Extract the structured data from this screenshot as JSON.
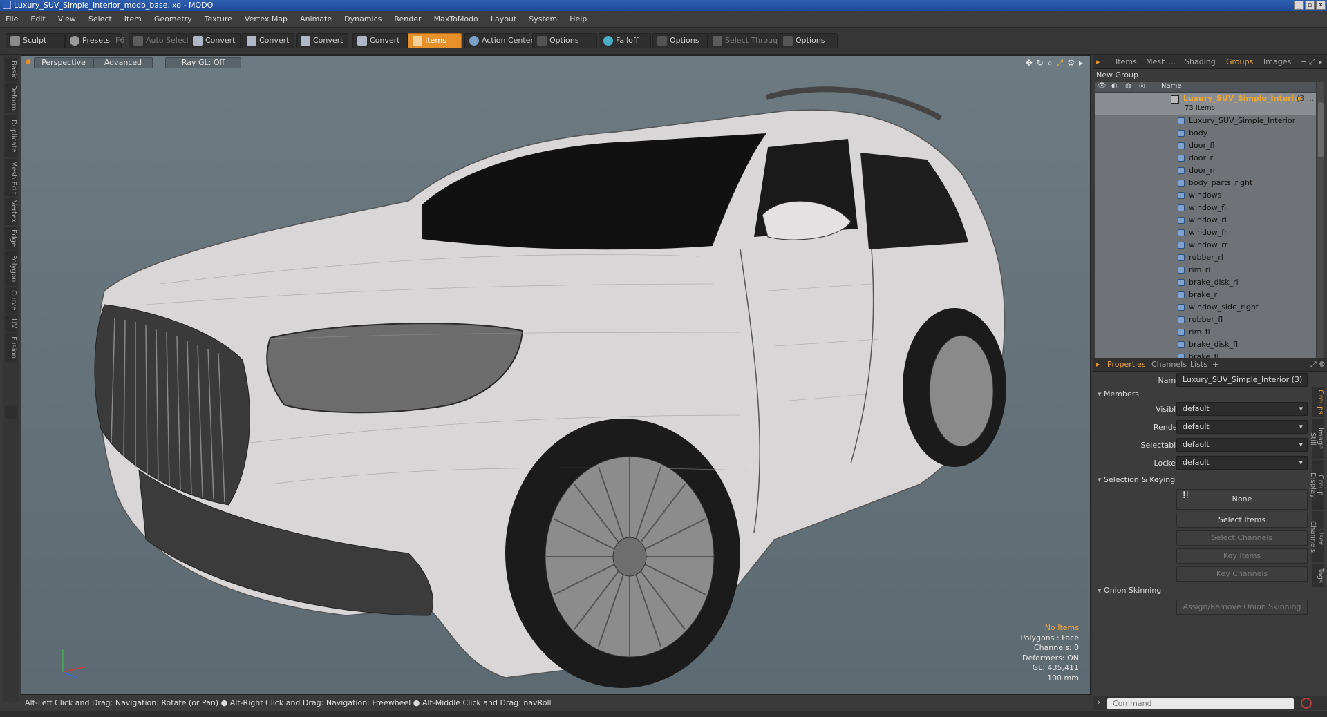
{
  "window": {
    "title": "Luxury_SUV_Simple_Interior_modo_base.lxo - MODO",
    "buttons": [
      "_",
      "▫",
      "✕"
    ]
  },
  "menu": [
    "File",
    "Edit",
    "View",
    "Select",
    "Item",
    "Geometry",
    "Texture",
    "Vertex Map",
    "Animate",
    "Dynamics",
    "Render",
    "MaxToModo",
    "Layout",
    "System",
    "Help"
  ],
  "toolbar": {
    "sculpt": "Sculpt",
    "presets": "Presets",
    "presets_key": "F6",
    "auto_select": "Auto Select",
    "convert1": "Convert",
    "convert2": "Convert",
    "convert3": "Convert",
    "convert4": "Convert",
    "items": "Items",
    "action_center": "Action Center",
    "options1": "Options",
    "falloff": "Falloff",
    "options2": "Options",
    "select_through": "Select Through",
    "options3": "Options"
  },
  "left_tabs": [
    "Basic",
    "Deform",
    "Duplicate",
    "Mesh Edit",
    "Vertex",
    "Edge",
    "Polygon",
    "Curve",
    "UV",
    "Fusion"
  ],
  "viewport": {
    "perspective": "Perspective",
    "advanced": "Advanced",
    "raygl": "Ray GL: Off",
    "info": {
      "no_items": "No Items",
      "polygons": "Polygons : Face",
      "channels": "Channels: 0",
      "deformers": "Deformers: ON",
      "gl": "GL: 435,411",
      "scale": "100 mm"
    }
  },
  "status": "Alt-Left Click and Drag: Navigation: Rotate (or Pan) ● Alt-Right Click and Drag: Navigation: Freewheel ● Alt-Middle Click and Drag: navRoll",
  "top_tabs": {
    "items": "Items",
    "mesh": "Mesh ...",
    "shading": "Shading",
    "groups": "Groups",
    "images": "Images",
    "plus": "+"
  },
  "groups": {
    "new_group": "New Group",
    "name_header": "Name",
    "root_name": "Luxury_SUV_Simple_Interior",
    "root_suffix": "(3 ...",
    "count": "73 Items",
    "items": [
      "Luxury_SUV_Simple_Interior",
      "body",
      "door_fl",
      "door_rl",
      "door_rr",
      "body_parts_right",
      "windows",
      "window_fl",
      "window_rl",
      "window_fr",
      "window_rr",
      "rubber_rl",
      "rim_rl",
      "brake_disk_rl",
      "brake_rl",
      "window_side_right",
      "rubber_fl",
      "rim_fl",
      "brake_disk_fl",
      "brake_fl"
    ]
  },
  "prop_tabs": {
    "properties": "Properties",
    "channels": "Channels",
    "lists": "Lists",
    "plus": "+"
  },
  "properties": {
    "name_label": "Name",
    "name_value": "Luxury_SUV_Simple_Interior (3)",
    "members": "Members",
    "visible_label": "Visible",
    "visible_value": "default",
    "render_label": "Render",
    "render_value": "default",
    "selectable_label": "Selectable",
    "selectable_value": "default",
    "locked_label": "Locked",
    "locked_value": "default",
    "selection_keying": "Selection & Keying",
    "none": "None",
    "select_items": "Select Items",
    "select_channels": "Select Channels",
    "key_items": "Key Items",
    "key_channels": "Key Channels",
    "onion": "Onion Skinning",
    "assign_onion": "Assign/Remove Onion Skinning"
  },
  "right_vtabs": [
    "Groups",
    "Image Still",
    "Group Display",
    "User Channels",
    "Tags"
  ],
  "command": {
    "placeholder": "Command"
  }
}
